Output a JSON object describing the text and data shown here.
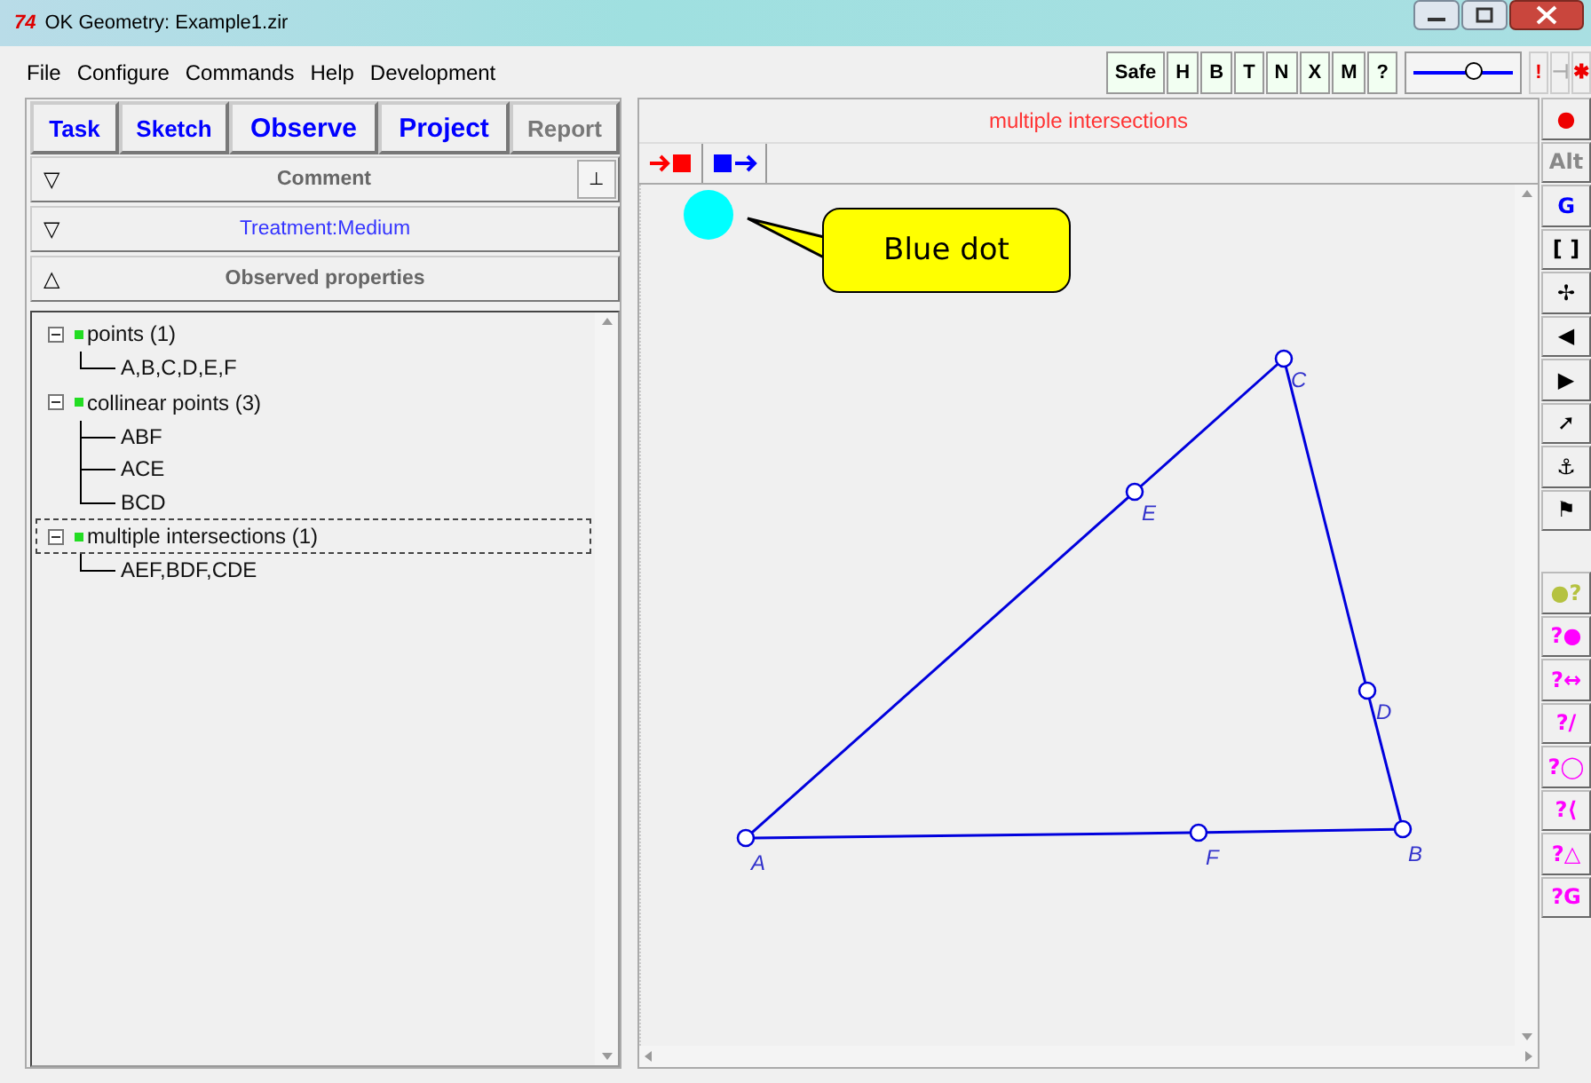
{
  "window": {
    "logo": "74",
    "title": "OK Geometry:  Example1.zir"
  },
  "menu": [
    "File",
    "Configure",
    "Commands",
    "Help",
    "Development"
  ],
  "toolbar": {
    "buttons": [
      "Safe",
      "H",
      "B",
      "T",
      "N",
      "X",
      "M",
      "?"
    ],
    "slider": {
      "level": 0.6
    },
    "marks": [
      {
        "text": "!",
        "kind": "alert"
      },
      {
        "text": "⊣",
        "kind": "dim"
      },
      {
        "text": "✱",
        "kind": "alert"
      }
    ]
  },
  "tabs": [
    {
      "label": "Task",
      "kind": "small"
    },
    {
      "label": "Sketch",
      "kind": "small"
    },
    {
      "label": "Observe",
      "kind": "large"
    },
    {
      "label": "Project",
      "kind": "large"
    },
    {
      "label": "Report",
      "kind": "muted"
    }
  ],
  "sections": [
    {
      "toggle": "▽",
      "label": "Comment",
      "kind": "plain",
      "pin": "⊥"
    },
    {
      "toggle": "▽",
      "label": "Treatment:Medium",
      "kind": "link"
    },
    {
      "toggle": "△",
      "label": "Observed properties",
      "kind": "plain"
    }
  ],
  "tree": [
    {
      "label": "points (1)",
      "selected": false,
      "children": [
        {
          "label": "A,B,C,D,E,F"
        }
      ]
    },
    {
      "label": "collinear points (3)",
      "selected": false,
      "children": [
        {
          "label": "ABF"
        },
        {
          "label": "ACE"
        },
        {
          "label": "BCD"
        }
      ]
    },
    {
      "label": "multiple intersections (1)",
      "selected": true,
      "children": [
        {
          "label": "AEF,BDF,CDE"
        }
      ]
    }
  ],
  "canvas": {
    "title": "multiple intersections",
    "callout": "Blue dot",
    "points": [
      {
        "label": "A"
      },
      {
        "label": "B"
      },
      {
        "label": "C"
      },
      {
        "label": "D"
      },
      {
        "label": "E"
      },
      {
        "label": "F"
      }
    ]
  },
  "side_tools": [
    {
      "text": "●",
      "kind": "red"
    },
    {
      "text": "Alt",
      "kind": "grey"
    },
    {
      "text": "G",
      "kind": "blue"
    },
    {
      "text": "[ ]",
      "kind": "black"
    },
    {
      "text": "✢",
      "kind": "black"
    },
    {
      "text": "◀",
      "kind": "black"
    },
    {
      "text": "▶",
      "kind": "black"
    },
    {
      "text": "➚",
      "kind": "black"
    },
    {
      "text": "⚓",
      "kind": "black"
    },
    {
      "text": "⚑",
      "kind": "black"
    }
  ],
  "query_tools": [
    {
      "text": "●?",
      "kind": "olive"
    },
    {
      "text": "?●",
      "kind": "magenta"
    },
    {
      "text": "?↔",
      "kind": "magenta"
    },
    {
      "text": "?/",
      "kind": "magenta"
    },
    {
      "text": "?◯",
      "kind": "magenta"
    },
    {
      "text": "?⟨",
      "kind": "magenta"
    },
    {
      "text": "?△",
      "kind": "magenta"
    },
    {
      "text": "?G",
      "kind": "magenta"
    }
  ]
}
